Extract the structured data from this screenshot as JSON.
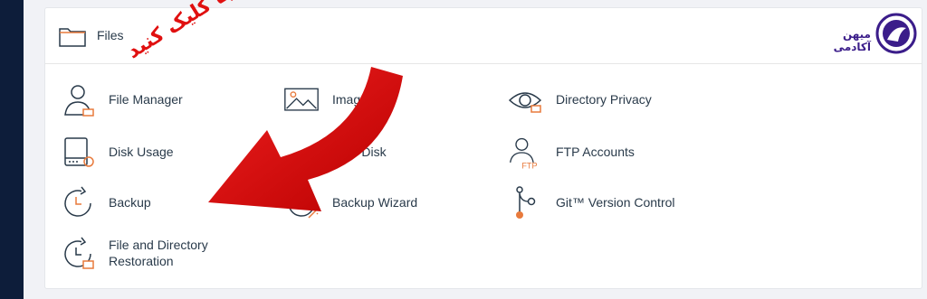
{
  "panel": {
    "title": "Files",
    "folder_icon": "folder-icon"
  },
  "logo": {
    "text": "میهن آکادمی",
    "icon": "academy-logo-icon",
    "color": "#3b1d8a"
  },
  "items": [
    {
      "label": "File Manager",
      "icon": "file-manager-icon"
    },
    {
      "label": "Images",
      "icon": "images-icon"
    },
    {
      "label": "Directory Privacy",
      "icon": "directory-privacy-icon"
    },
    {
      "label": "Disk Usage",
      "icon": "disk-usage-icon"
    },
    {
      "label": "Web Disk",
      "icon": "web-disk-icon"
    },
    {
      "label": "FTP Accounts",
      "icon": "ftp-accounts-icon"
    },
    {
      "label": "Backup",
      "icon": "backup-icon"
    },
    {
      "label": "Backup Wizard",
      "icon": "backup-wizard-icon"
    },
    {
      "label": "Git™ Version Control",
      "icon": "git-icon"
    },
    {
      "label_line1": "File and Directory",
      "label_line2": "Restoration",
      "icon": "restore-icon"
    }
  ],
  "overlay": {
    "text": "اینجا کلیک کنید",
    "color": "#e01010",
    "icon": "red-arrow-icon"
  },
  "colors": {
    "text": "#293a4a",
    "accent": "#e87a3c",
    "background": "#f1f2f6",
    "sidebar": "#0d1d3a"
  }
}
